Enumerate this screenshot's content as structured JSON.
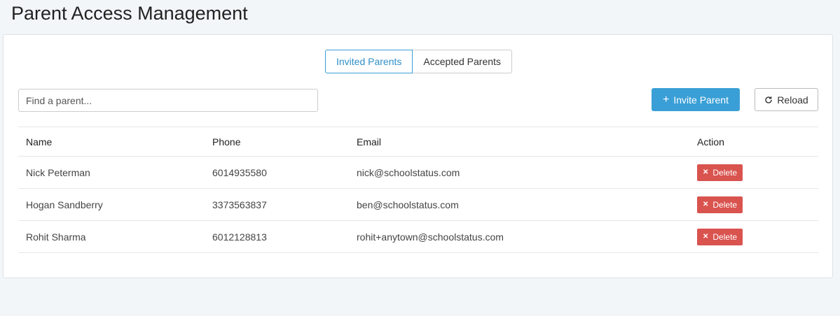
{
  "page": {
    "title": "Parent Access Management"
  },
  "tabs": [
    {
      "label": "Invited Parents",
      "active": true
    },
    {
      "label": "Accepted Parents",
      "active": false
    }
  ],
  "search": {
    "placeholder": "Find a parent...",
    "value": ""
  },
  "toolbar": {
    "invite_label": "Invite Parent",
    "reload_label": "Reload"
  },
  "colors": {
    "primary": "#3a9fd6",
    "danger": "#d9534f"
  },
  "table": {
    "headers": [
      "Name",
      "Phone",
      "Email",
      "Action"
    ],
    "rows": [
      {
        "name": "Nick Peterman",
        "phone": "6014935580",
        "email": "nick@schoolstatus.com",
        "action": "Delete"
      },
      {
        "name": "Hogan Sandberry",
        "phone": "3373563837",
        "email": "ben@schoolstatus.com",
        "action": "Delete"
      },
      {
        "name": "Rohit Sharma",
        "phone": "6012128813",
        "email": "rohit+anytown@schoolstatus.com",
        "action": "Delete"
      }
    ]
  }
}
